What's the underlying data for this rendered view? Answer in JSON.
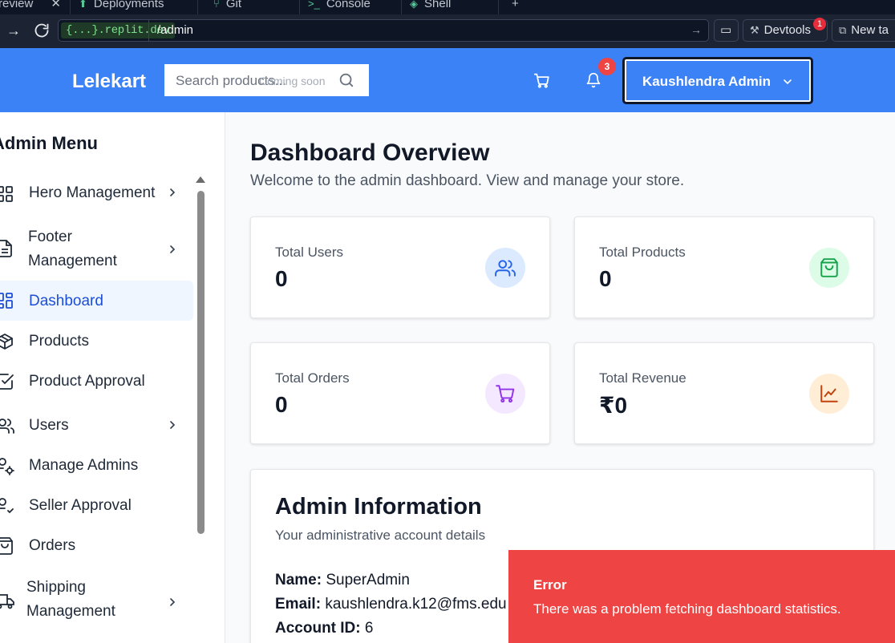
{
  "browser": {
    "tabs": [
      {
        "label": "review"
      },
      {
        "label": "Deployments"
      },
      {
        "label": "Git"
      },
      {
        "label": "Console"
      },
      {
        "label": "Shell"
      }
    ],
    "url_host": "{...}.replit.dev",
    "url_path": "/admin",
    "devtools_label": "Devtools",
    "devtools_badge": "1",
    "newtab_label": "New ta"
  },
  "header": {
    "logo": "Lelekart",
    "search_placeholder": "Search products...",
    "search_hint": "Coming soon",
    "notification_count": "3",
    "user_name": "Kaushlendra Admin",
    "accent_color": "#3b82f6"
  },
  "sidebar": {
    "title": "Admin Menu",
    "items": [
      {
        "label": "Hero Management",
        "icon": "grid-icon"
      },
      {
        "label": "Footer Management",
        "line1": "Footer",
        "line2": "Management",
        "icon": "document-icon"
      },
      {
        "label": "Dashboard",
        "icon": "layout-icon",
        "active": true
      },
      {
        "label": "Products",
        "icon": "box-icon"
      },
      {
        "label": "Product Approval",
        "icon": "check-square-icon"
      },
      {
        "label": "Users",
        "icon": "users-icon"
      },
      {
        "label": "Manage Admins",
        "icon": "user-cog-icon"
      },
      {
        "label": "Seller Approval",
        "icon": "user-check-icon"
      },
      {
        "label": "Orders",
        "icon": "shopping-bag-icon"
      },
      {
        "label": "Shipping Management",
        "line1": "Shipping",
        "line2": "Management",
        "icon": "truck-icon"
      }
    ]
  },
  "main": {
    "title": "Dashboard Overview",
    "subtitle": "Welcome to the admin dashboard. View and manage your store.",
    "stats": [
      {
        "label": "Total Users",
        "value": "0",
        "icon": "users-icon",
        "color": "#2563eb",
        "bg": "#dbeafe"
      },
      {
        "label": "Total Products",
        "value": "0",
        "icon": "shopping-bag-icon",
        "color": "#16a34a",
        "bg": "#dcfce7"
      },
      {
        "label": "Total Orders",
        "value": "0",
        "icon": "shopping-cart-icon",
        "color": "#9333ea",
        "bg": "#f3e8ff"
      },
      {
        "label": "Total Revenue",
        "value": "₹0",
        "icon": "line-chart-icon",
        "color": "#c2410c",
        "bg": "#ffedd5"
      }
    ],
    "admin_info": {
      "title": "Admin Information",
      "subtitle": "Your administrative account details",
      "name_label": "Name:",
      "name_value": "SuperAdmin",
      "email_label": "Email:",
      "email_value": "kaushlendra.k12@fms.edu",
      "id_label": "Account ID:",
      "id_value": "6"
    }
  },
  "toast": {
    "title": "Error",
    "message": "There was a problem fetching dashboard statistics.",
    "color": "#ef4444"
  }
}
